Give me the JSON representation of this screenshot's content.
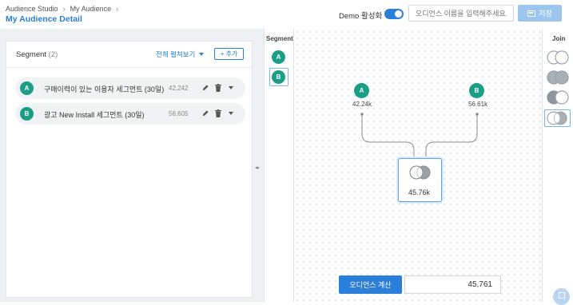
{
  "header": {
    "breadcrumb": [
      "Audience Studio",
      "My Audience"
    ],
    "title": "My Audience Detail",
    "demo_label": "Demo 활성화",
    "name_placeholder": "오디언스 이름을 입력해주세요.",
    "save_label": "저장"
  },
  "segment_panel": {
    "title": "Segment",
    "count": "(2)",
    "view_all_label": "전체 펼쳐보기",
    "add_label": "+ 추가",
    "items": [
      {
        "badge": "A",
        "name": "구매이력이 있는 이용자 세그먼트 (30일)",
        "size": "42,242"
      },
      {
        "badge": "B",
        "name": "광고 New Install 세그먼트 (30일)",
        "size": "56,605"
      }
    ]
  },
  "segment_column": {
    "title": "Segment",
    "badges": [
      "A",
      "B"
    ]
  },
  "canvas": {
    "nodes": [
      {
        "badge": "A",
        "label": "42.24k"
      },
      {
        "badge": "B",
        "label": "56.61k"
      }
    ],
    "join_result_label": "45.76k",
    "calc_label": "오디언스 계산",
    "result_value": "45,761"
  },
  "join_column": {
    "title": "Join",
    "options": [
      "left-exclusive-join-icon",
      "union-join-icon",
      "right-exclusive-join-icon",
      "intersection-join-icon"
    ],
    "selected": "intersection-join-icon"
  },
  "colors": {
    "accent": "#2b7fd9",
    "segment_badge": "#1a9e86",
    "selection_border": "#7db6ea"
  }
}
